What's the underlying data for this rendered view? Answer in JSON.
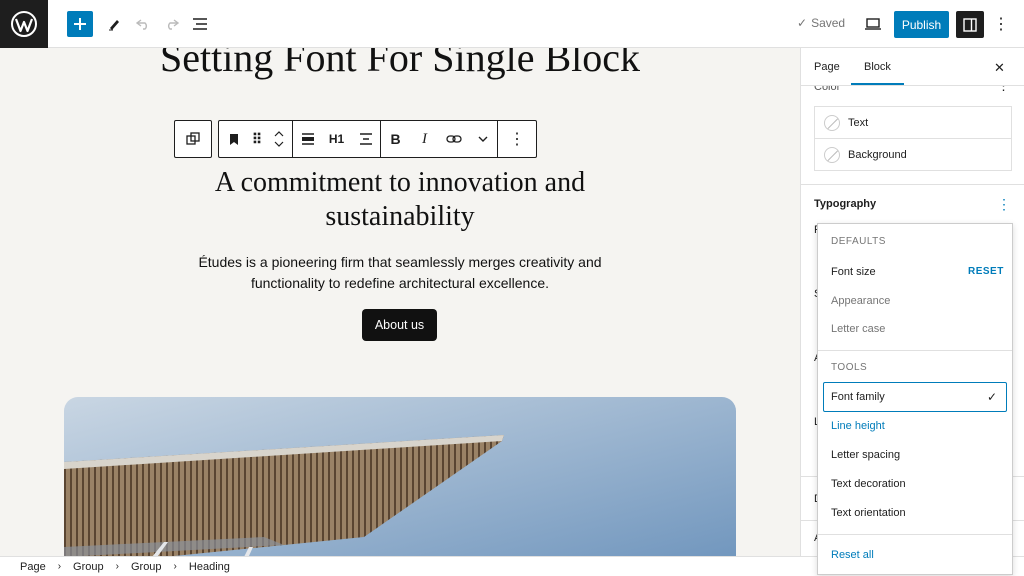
{
  "topbar": {
    "saved_label": "Saved",
    "publish_label": "Publish"
  },
  "canvas": {
    "page_heading": "Setting Font For Single Block",
    "block_toolbar": {
      "heading_level": "H1",
      "bold": "B",
      "italic": "I"
    },
    "commit_heading": "A commitment to innovation and sustainability",
    "intro": "Études is a pioneering firm that seamlessly merges creativity and functionality to redefine architectural excellence.",
    "about_button": "About us"
  },
  "sidebar": {
    "tabs": [
      "Page",
      "Block"
    ],
    "active_tab": "Block",
    "color_title": "Color",
    "color_items": [
      "Text",
      "Background"
    ],
    "typography_title": "Typography",
    "ghost_letters": [
      "F",
      "S",
      "A",
      "L",
      "D",
      "A"
    ]
  },
  "dropdown": {
    "defaults_label": "DEFAULTS",
    "defaults_items": [
      "Font size",
      "Appearance",
      "Letter case"
    ],
    "reset_label": "RESET",
    "tools_label": "TOOLS",
    "tools_items": [
      "Font family",
      "Line height",
      "Letter spacing",
      "Text decoration",
      "Text orientation"
    ],
    "selected_item": "Font family",
    "reset_all_label": "Reset all"
  },
  "breadcrumb": [
    "Page",
    "Group",
    "Group",
    "Heading"
  ],
  "colors": {
    "accent": "#007cba",
    "dark": "#1e1e1e",
    "canvas_bg": "#f5f4f1"
  }
}
